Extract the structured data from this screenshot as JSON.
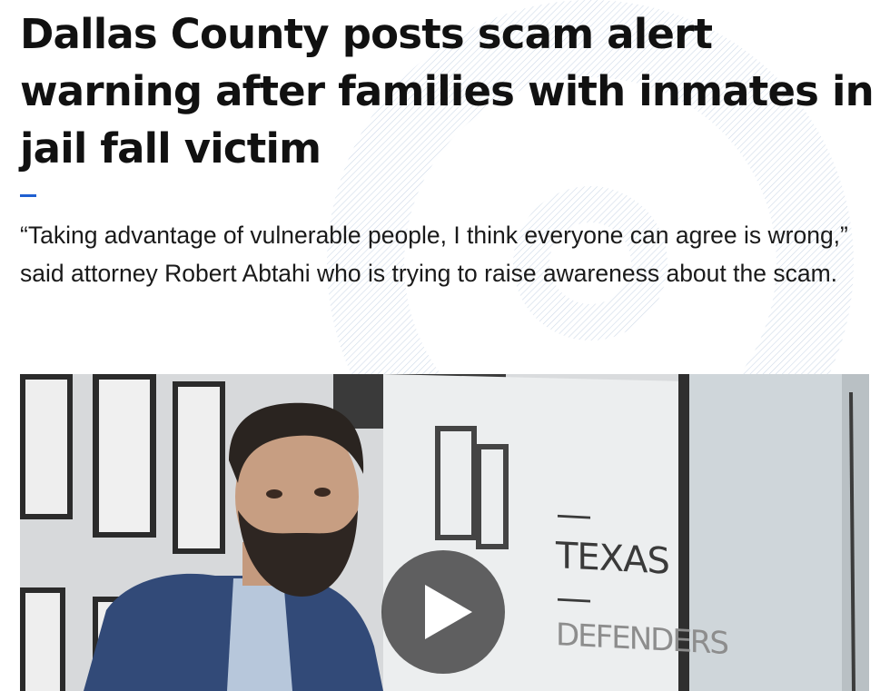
{
  "article": {
    "headline": "Dallas County posts scam alert warning after families with inmates in jail fall victim",
    "dek": "“Taking advantage of vulnerable people, I think everyone can agree is wrong,” said attorney Robert Abtahi who is trying to raise awareness about the scam."
  },
  "video": {
    "play_icon": "play-icon",
    "sign_line1": "— TEXAS —",
    "sign_line2": "DEFENDERS"
  },
  "colors": {
    "accent": "#1f5fd1",
    "headline": "#111111",
    "pattern": "#c9d6e6"
  }
}
